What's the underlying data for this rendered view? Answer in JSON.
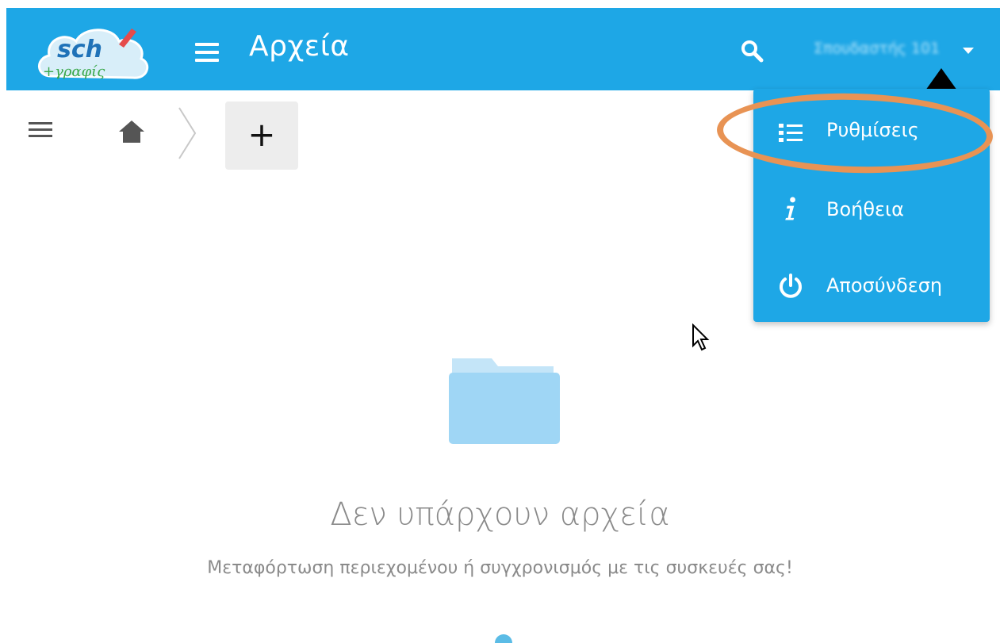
{
  "header": {
    "logo": {
      "line1": "sch",
      "line2": "+γραφίς"
    },
    "title": "Αρχεία",
    "user_name": "Σπουδαστής 101"
  },
  "toolbar": {
    "add_label": "+"
  },
  "dropdown": {
    "items": [
      {
        "label": "Ρυθμίσεις",
        "icon": "settings-list-icon"
      },
      {
        "label": "Βοήθεια",
        "icon": "info-icon"
      },
      {
        "label": "Αποσύνδεση",
        "icon": "power-icon"
      }
    ]
  },
  "empty_state": {
    "title": "Δεν υπάρχουν αρχεία",
    "subtitle": "Μεταφόρτωση περιεχομένου ή συγχρονισμός με τις συσκευές σας!"
  },
  "colors": {
    "brand": "#1ea7e6",
    "annotation": "#e89354",
    "folder": "#9fd6f5",
    "text_muted": "#8a8a8a"
  }
}
